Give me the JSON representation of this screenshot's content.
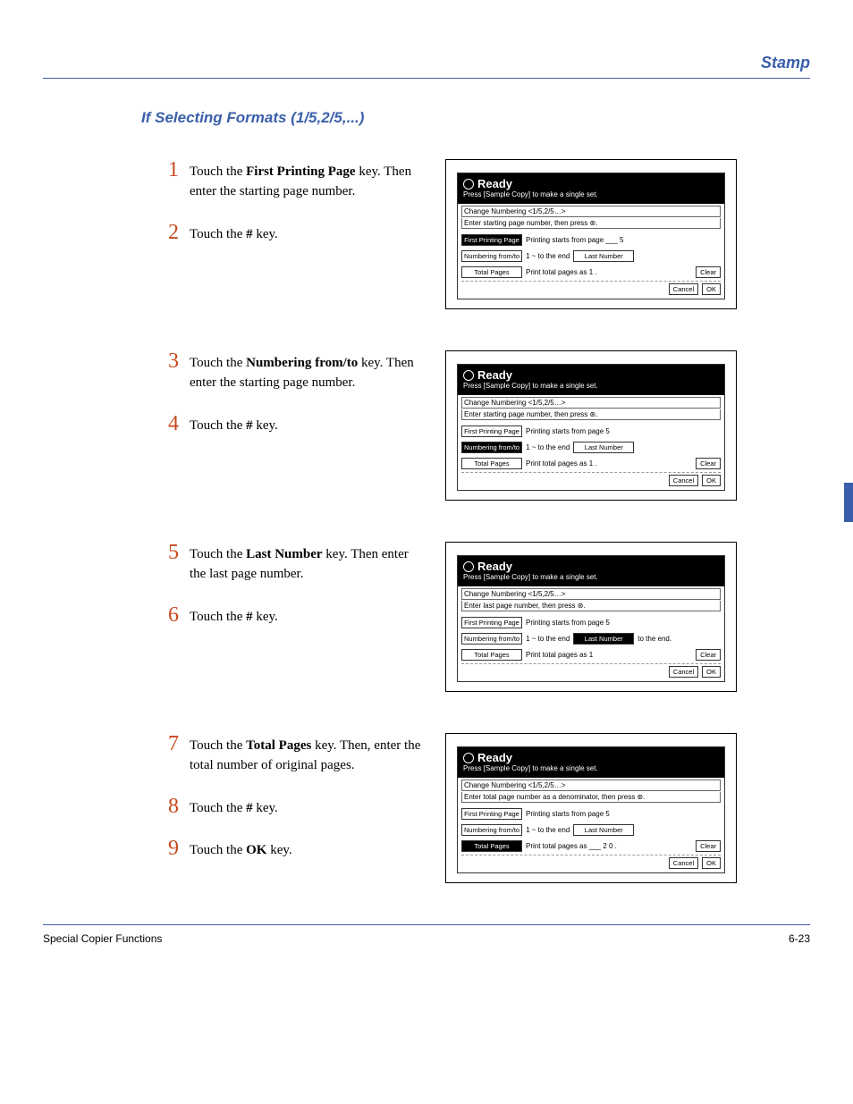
{
  "header": "Stamp",
  "section_title": "If Selecting Formats (1/5,2/5,...)",
  "blocks": [
    {
      "steps": [
        {
          "n": "1",
          "pre": "Touch the ",
          "bold": "First Printing Page",
          "post": " key. Then enter the starting page number."
        },
        {
          "n": "2",
          "pre": "Touch the ",
          "bold": "#",
          "post": " key."
        }
      ],
      "panel": {
        "ready": "Ready",
        "sample": "Press [Sample Copy] to make a single set.",
        "mode": "Change Numbering   <1/5,2/5…>",
        "instr": "Enter starting page number, then press ⊛.",
        "rows": [
          {
            "btn": "First Printing Page",
            "sel": true,
            "text": "Printing starts from page ___ 5",
            "btn2": null
          },
          {
            "btn": "Numbering from/to",
            "sel": false,
            "text": "1  ~  to the end",
            "btn2": "Last Number"
          },
          {
            "btn": "Total Pages",
            "sel": false,
            "text": "Print total pages as        1 .",
            "right": "Clear"
          }
        ],
        "actions": [
          "Cancel",
          "OK"
        ]
      }
    },
    {
      "steps": [
        {
          "n": "3",
          "pre": "Touch the ",
          "bold": "Numbering from/to",
          "post": " key. Then enter the starting page number."
        },
        {
          "n": "4",
          "pre": "Touch the ",
          "bold": "#",
          "post": " key."
        }
      ],
      "panel": {
        "ready": "Ready",
        "sample": "Press [Sample Copy] to make a single set.",
        "mode": "Change Numbering   <1/5,2/5…>",
        "instr": "Enter starting page number, then press ⊛.",
        "rows": [
          {
            "btn": "First Printing Page",
            "sel": false,
            "text": "Printing starts from page        5",
            "btn2": null
          },
          {
            "btn": "Numbering from/to",
            "sel": true,
            "text": "1  ~  to the end",
            "btn2": "Last Number"
          },
          {
            "btn": "Total Pages",
            "sel": false,
            "text": "Print total pages as        1 .",
            "right": "Clear"
          }
        ],
        "actions": [
          "Cancel",
          "OK"
        ]
      }
    },
    {
      "steps": [
        {
          "n": "5",
          "pre": "Touch the ",
          "bold": "Last Number",
          "post": " key. Then enter the last page number."
        },
        {
          "n": "6",
          "pre": "Touch the ",
          "bold": "#",
          "post": " key."
        }
      ],
      "panel": {
        "ready": "Ready",
        "sample": "Press [Sample Copy] to make a single set.",
        "mode": "Change Numbering   <1/5,2/5…>",
        "instr": "Enter last page number, then press ⊛.",
        "rows": [
          {
            "btn": "First Printing Page",
            "sel": false,
            "text": "Printing starts from page        5",
            "btn2": null
          },
          {
            "btn": "Numbering from/to",
            "sel": false,
            "text": "1  ~  to the end",
            "btn2": "Last Number",
            "btn2sel": true,
            "after": "to the end."
          },
          {
            "btn": "Total Pages",
            "sel": false,
            "text": "Print total pages as        1",
            "right": "Clear"
          }
        ],
        "actions": [
          "Cancel",
          "OK"
        ]
      }
    },
    {
      "steps": [
        {
          "n": "7",
          "pre": "Touch the ",
          "bold": "Total Pages",
          "post": " key. Then, enter the total number of original pages."
        },
        {
          "n": "8",
          "pre": "Touch the ",
          "bold": "#",
          "post": " key."
        },
        {
          "n": "9",
          "pre": "Touch the ",
          "bold": "OK",
          "post": " key."
        }
      ],
      "panel": {
        "ready": "Ready",
        "sample": "Press [Sample Copy] to make a single set.",
        "mode": "Change Numbering   <1/5,2/5…>",
        "instr": "Enter total page number as a denominator, then press ⊛.",
        "rows": [
          {
            "btn": "First Printing Page",
            "sel": false,
            "text": "Printing starts from page        5",
            "btn2": null
          },
          {
            "btn": "Numbering from/to",
            "sel": false,
            "text": "1  ~  to the end",
            "btn2": "Last Number"
          },
          {
            "btn": "Total Pages",
            "sel": true,
            "text": "Print total pages as ___ 2 0 .",
            "right": "Clear"
          }
        ],
        "actions": [
          "Cancel",
          "OK"
        ]
      }
    }
  ],
  "footer_left": "Special Copier Functions",
  "footer_right": "6‑23"
}
